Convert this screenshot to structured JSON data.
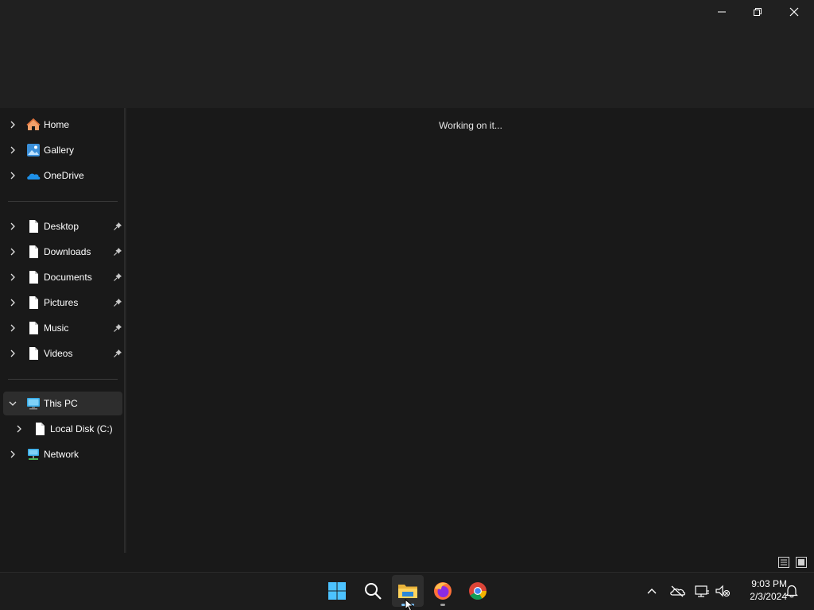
{
  "window": {
    "controls": {
      "minimize_icon": "minimize-icon",
      "maximize_icon": "restore-icon",
      "close_icon": "close-icon"
    }
  },
  "sidebar": {
    "groups": [
      {
        "items": [
          {
            "label": "Home",
            "icon": "home-icon"
          },
          {
            "label": "Gallery",
            "icon": "gallery-icon"
          },
          {
            "label": "OneDrive",
            "icon": "onedrive-icon"
          }
        ]
      },
      {
        "items": [
          {
            "label": "Desktop",
            "icon": "file-icon",
            "pinned": true
          },
          {
            "label": "Downloads",
            "icon": "file-icon",
            "pinned": true
          },
          {
            "label": "Documents",
            "icon": "file-icon",
            "pinned": true
          },
          {
            "label": "Pictures",
            "icon": "file-icon",
            "pinned": true
          },
          {
            "label": "Music",
            "icon": "file-icon",
            "pinned": true
          },
          {
            "label": "Videos",
            "icon": "file-icon",
            "pinned": true
          }
        ]
      },
      {
        "items": [
          {
            "label": "This PC",
            "icon": "computer-icon",
            "expanded": true,
            "selected": true
          },
          {
            "label": "Local Disk (C:)",
            "icon": "file-icon",
            "child": true
          },
          {
            "label": "Network",
            "icon": "network-icon"
          }
        ]
      }
    ]
  },
  "content": {
    "status": "Working on it..."
  },
  "statusbar": {
    "views": [
      "details-view-icon",
      "tiles-view-icon"
    ]
  },
  "taskbar": {
    "apps": [
      {
        "name": "Start",
        "icon": "windows-logo-icon"
      },
      {
        "name": "Search",
        "icon": "search-icon"
      },
      {
        "name": "File Explorer",
        "icon": "file-explorer-icon",
        "active": true
      },
      {
        "name": "Firefox",
        "icon": "firefox-icon",
        "running": true
      },
      {
        "name": "Chrome",
        "icon": "chrome-icon"
      }
    ],
    "tray": {
      "icons": [
        "chevron-up-icon",
        "onedrive-offline-icon",
        "network-disconnected-icon",
        "volume-muted-icon",
        "notifications-icon"
      ],
      "time": "9:03 PM",
      "date": "2/3/2024"
    }
  },
  "colors": {
    "accent": "#7dc3ff",
    "background": "#191919",
    "titlebar": "#202020"
  }
}
